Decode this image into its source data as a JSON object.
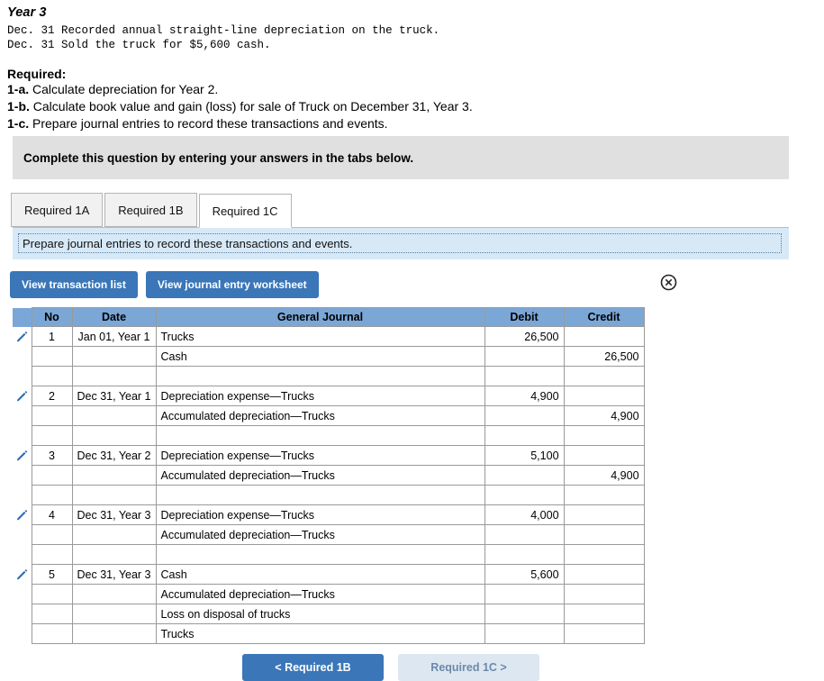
{
  "problem": {
    "year_heading": "Year 3",
    "events": [
      "Dec. 31 Recorded annual straight-line depreciation on the truck.",
      "Dec. 31 Sold the truck for $5,600 cash."
    ],
    "required_heading": "Required:",
    "required_items": [
      {
        "label": "1-a.",
        "text": "Calculate depreciation for Year 2."
      },
      {
        "label": "1-b.",
        "text": "Calculate book value and gain (loss) for sale of Truck on December 31, Year 3."
      },
      {
        "label": "1-c.",
        "text": "Prepare journal entries to record these transactions and events."
      }
    ]
  },
  "banner": {
    "text": "Complete this question by entering your answers in the tabs below."
  },
  "tabs": [
    {
      "label": "Required 1A",
      "active": false
    },
    {
      "label": "Required 1B",
      "active": false
    },
    {
      "label": "Required 1C",
      "active": true
    }
  ],
  "tab_instruction": {
    "text": "Prepare journal entries to record these transactions and events."
  },
  "actions": {
    "view_transaction_list": "View transaction list",
    "view_journal_entry_worksheet": "View journal entry worksheet",
    "close_icon": "close-circle-icon"
  },
  "table": {
    "headers": {
      "no": "No",
      "date": "Date",
      "general_journal": "General Journal",
      "debit": "Debit",
      "credit": "Credit"
    },
    "rows": [
      {
        "kind": "entry",
        "pencil": true,
        "no": "1",
        "date": "Jan 01, Year 1",
        "account": "Trucks",
        "indent": false,
        "debit": "26,500",
        "credit": ""
      },
      {
        "kind": "line",
        "pencil": false,
        "no": "",
        "date": "",
        "account": "Cash",
        "indent": true,
        "debit": "",
        "credit": "26,500"
      },
      {
        "kind": "spacer",
        "pencil": false,
        "no": "",
        "date": "",
        "account": "",
        "indent": false,
        "debit": "",
        "credit": ""
      },
      {
        "kind": "entry",
        "pencil": true,
        "no": "2",
        "date": "Dec 31, Year 1",
        "account": "Depreciation expense—Trucks",
        "indent": false,
        "debit": "4,900",
        "credit": ""
      },
      {
        "kind": "line",
        "pencil": false,
        "no": "",
        "date": "",
        "account": "Accumulated depreciation—Trucks",
        "indent": true,
        "debit": "",
        "credit": "4,900"
      },
      {
        "kind": "spacer",
        "pencil": false,
        "no": "",
        "date": "",
        "account": "",
        "indent": false,
        "debit": "",
        "credit": ""
      },
      {
        "kind": "entry",
        "pencil": true,
        "no": "3",
        "date": "Dec 31, Year 2",
        "account": "Depreciation expense—Trucks",
        "indent": false,
        "debit": "5,100",
        "credit": ""
      },
      {
        "kind": "line",
        "pencil": false,
        "no": "",
        "date": "",
        "account": "Accumulated depreciation—Trucks",
        "indent": true,
        "debit": "",
        "credit": "4,900"
      },
      {
        "kind": "spacer",
        "pencil": false,
        "no": "",
        "date": "",
        "account": "",
        "indent": false,
        "debit": "",
        "credit": ""
      },
      {
        "kind": "entry",
        "pencil": true,
        "no": "4",
        "date": "Dec 31, Year 3",
        "account": "Depreciation expense—Trucks",
        "indent": false,
        "debit": "4,000",
        "credit": ""
      },
      {
        "kind": "line",
        "pencil": false,
        "no": "",
        "date": "",
        "account": "Accumulated depreciation—Trucks",
        "indent": false,
        "debit": "",
        "credit": ""
      },
      {
        "kind": "spacer",
        "pencil": false,
        "no": "",
        "date": "",
        "account": "",
        "indent": false,
        "debit": "",
        "credit": ""
      },
      {
        "kind": "entry",
        "pencil": true,
        "no": "5",
        "date": "Dec 31, Year 3",
        "account": "Cash",
        "indent": false,
        "debit": "5,600",
        "credit": ""
      },
      {
        "kind": "line",
        "pencil": false,
        "no": "",
        "date": "",
        "account": "Accumulated depreciation—Trucks",
        "indent": false,
        "debit": "",
        "credit": ""
      },
      {
        "kind": "line",
        "pencil": false,
        "no": "",
        "date": "",
        "account": "Loss on disposal of trucks",
        "indent": false,
        "debit": "",
        "credit": ""
      },
      {
        "kind": "line",
        "pencil": false,
        "no": "",
        "date": "",
        "account": "Trucks",
        "indent": false,
        "debit": "",
        "credit": ""
      }
    ]
  },
  "bottom_nav": {
    "prev": "< Required 1B",
    "next": "Required 1C >"
  },
  "colors": {
    "header_blue": "#7ba7d7",
    "button_blue": "#3a76b8",
    "panel_blue": "#d7e9f7",
    "banner_gray": "#e0e0e0"
  }
}
